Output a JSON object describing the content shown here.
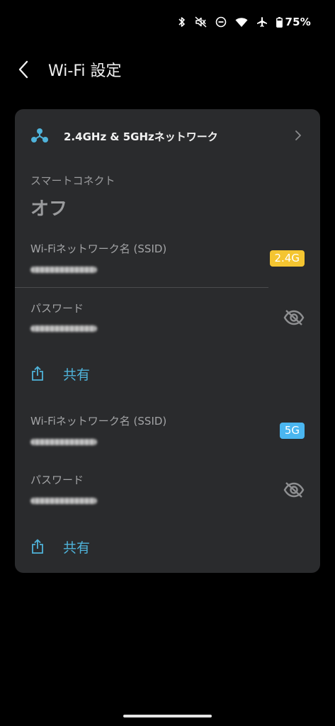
{
  "status": {
    "battery_percent": "75%",
    "icons": [
      "bluetooth-icon",
      "mute-icon",
      "do-not-disturb-icon",
      "wifi-icon",
      "airplane-icon",
      "battery-icon"
    ]
  },
  "header": {
    "title": "Wi-Fi 設定",
    "back_icon": "chevron-left-icon"
  },
  "card": {
    "network_icon": "mesh-network-icon",
    "network_label": "2.4GHz & 5GHzネットワーク",
    "smart_connect_label": "スマートコネクト",
    "smart_connect_value": "オフ",
    "band_24": {
      "ssid_label": "Wi-Fiネットワーク名 (SSID)",
      "ssid_value": "••••••••••••••",
      "badge": "2.4G",
      "password_label": "パスワード",
      "password_value": "••••••••••••••",
      "share_label": "共有"
    },
    "band_5": {
      "ssid_label": "Wi-Fiネットワーク名 (SSID)",
      "ssid_value": "••••••••••••••",
      "badge": "5G",
      "password_label": "パスワード",
      "password_value": "••••••••••••••",
      "share_label": "共有"
    }
  },
  "colors": {
    "background": "#000000",
    "card": "#2a2b2d",
    "accent": "#4fb3da",
    "badge_24": "#f4c531",
    "badge_5": "#4ab6f0"
  }
}
